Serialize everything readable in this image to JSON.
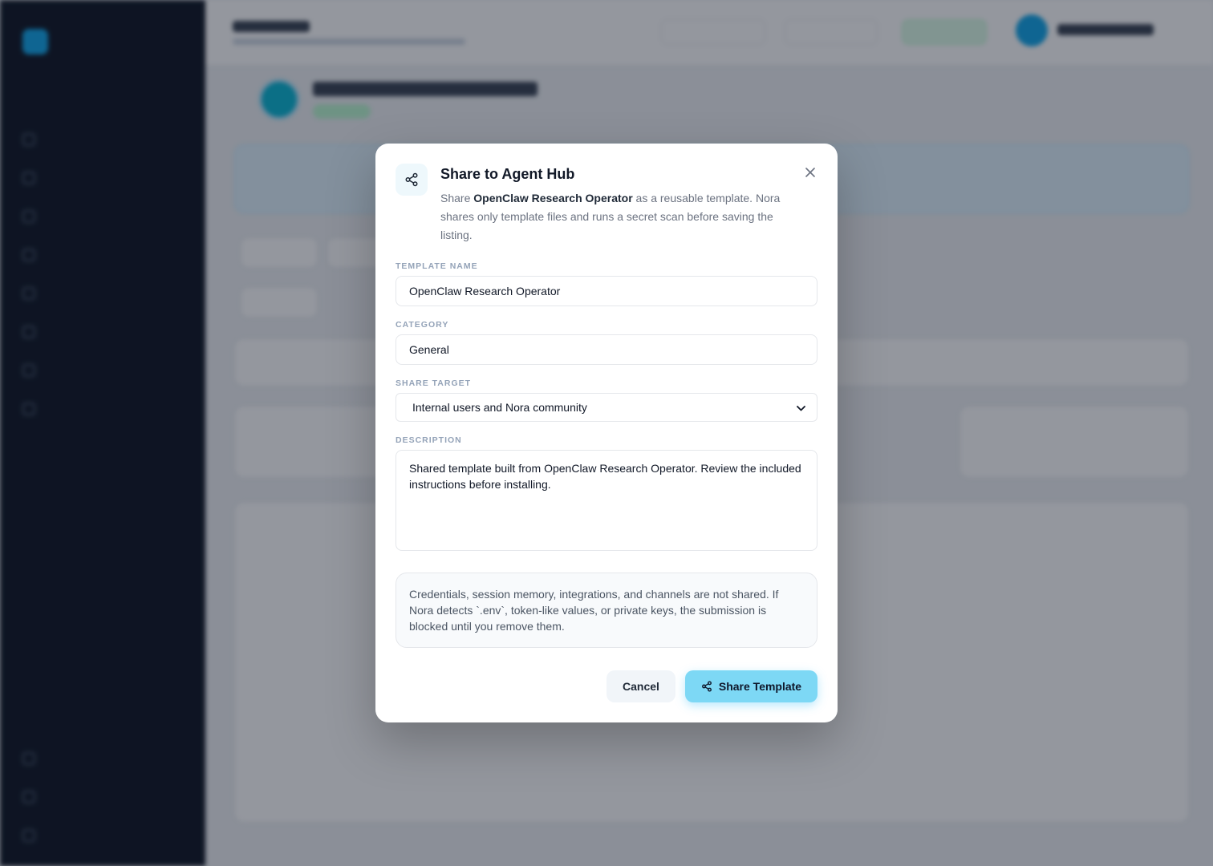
{
  "modal": {
    "title": "Share to Agent Hub",
    "description_prefix": "Share ",
    "agent_name": "OpenClaw Research Operator",
    "description_suffix": " as a reusable template. Nora shares only template files and runs a secret scan before saving the listing.",
    "template_name": {
      "label": "TEMPLATE NAME",
      "value": "OpenClaw Research Operator"
    },
    "category": {
      "label": "CATEGORY",
      "value": "General"
    },
    "share_target": {
      "label": "SHARE TARGET",
      "selected": "Internal users and Nora community"
    },
    "description": {
      "label": "DESCRIPTION",
      "value": "Shared template built from OpenClaw Research Operator. Review the included instructions before installing."
    },
    "notice": "Credentials, session memory, integrations, and channels are not shared. If Nora detects `.env`, token-like values, or private keys, the submission is blocked until you remove them.",
    "cancel_label": "Cancel",
    "share_label": "Share Template",
    "icons": {
      "header": "share-icon",
      "close": "close-icon",
      "button": "share-icon"
    },
    "colors": {
      "accent": "#7dd8f5",
      "overlay": "rgba(17,24,39,0.45)"
    }
  }
}
